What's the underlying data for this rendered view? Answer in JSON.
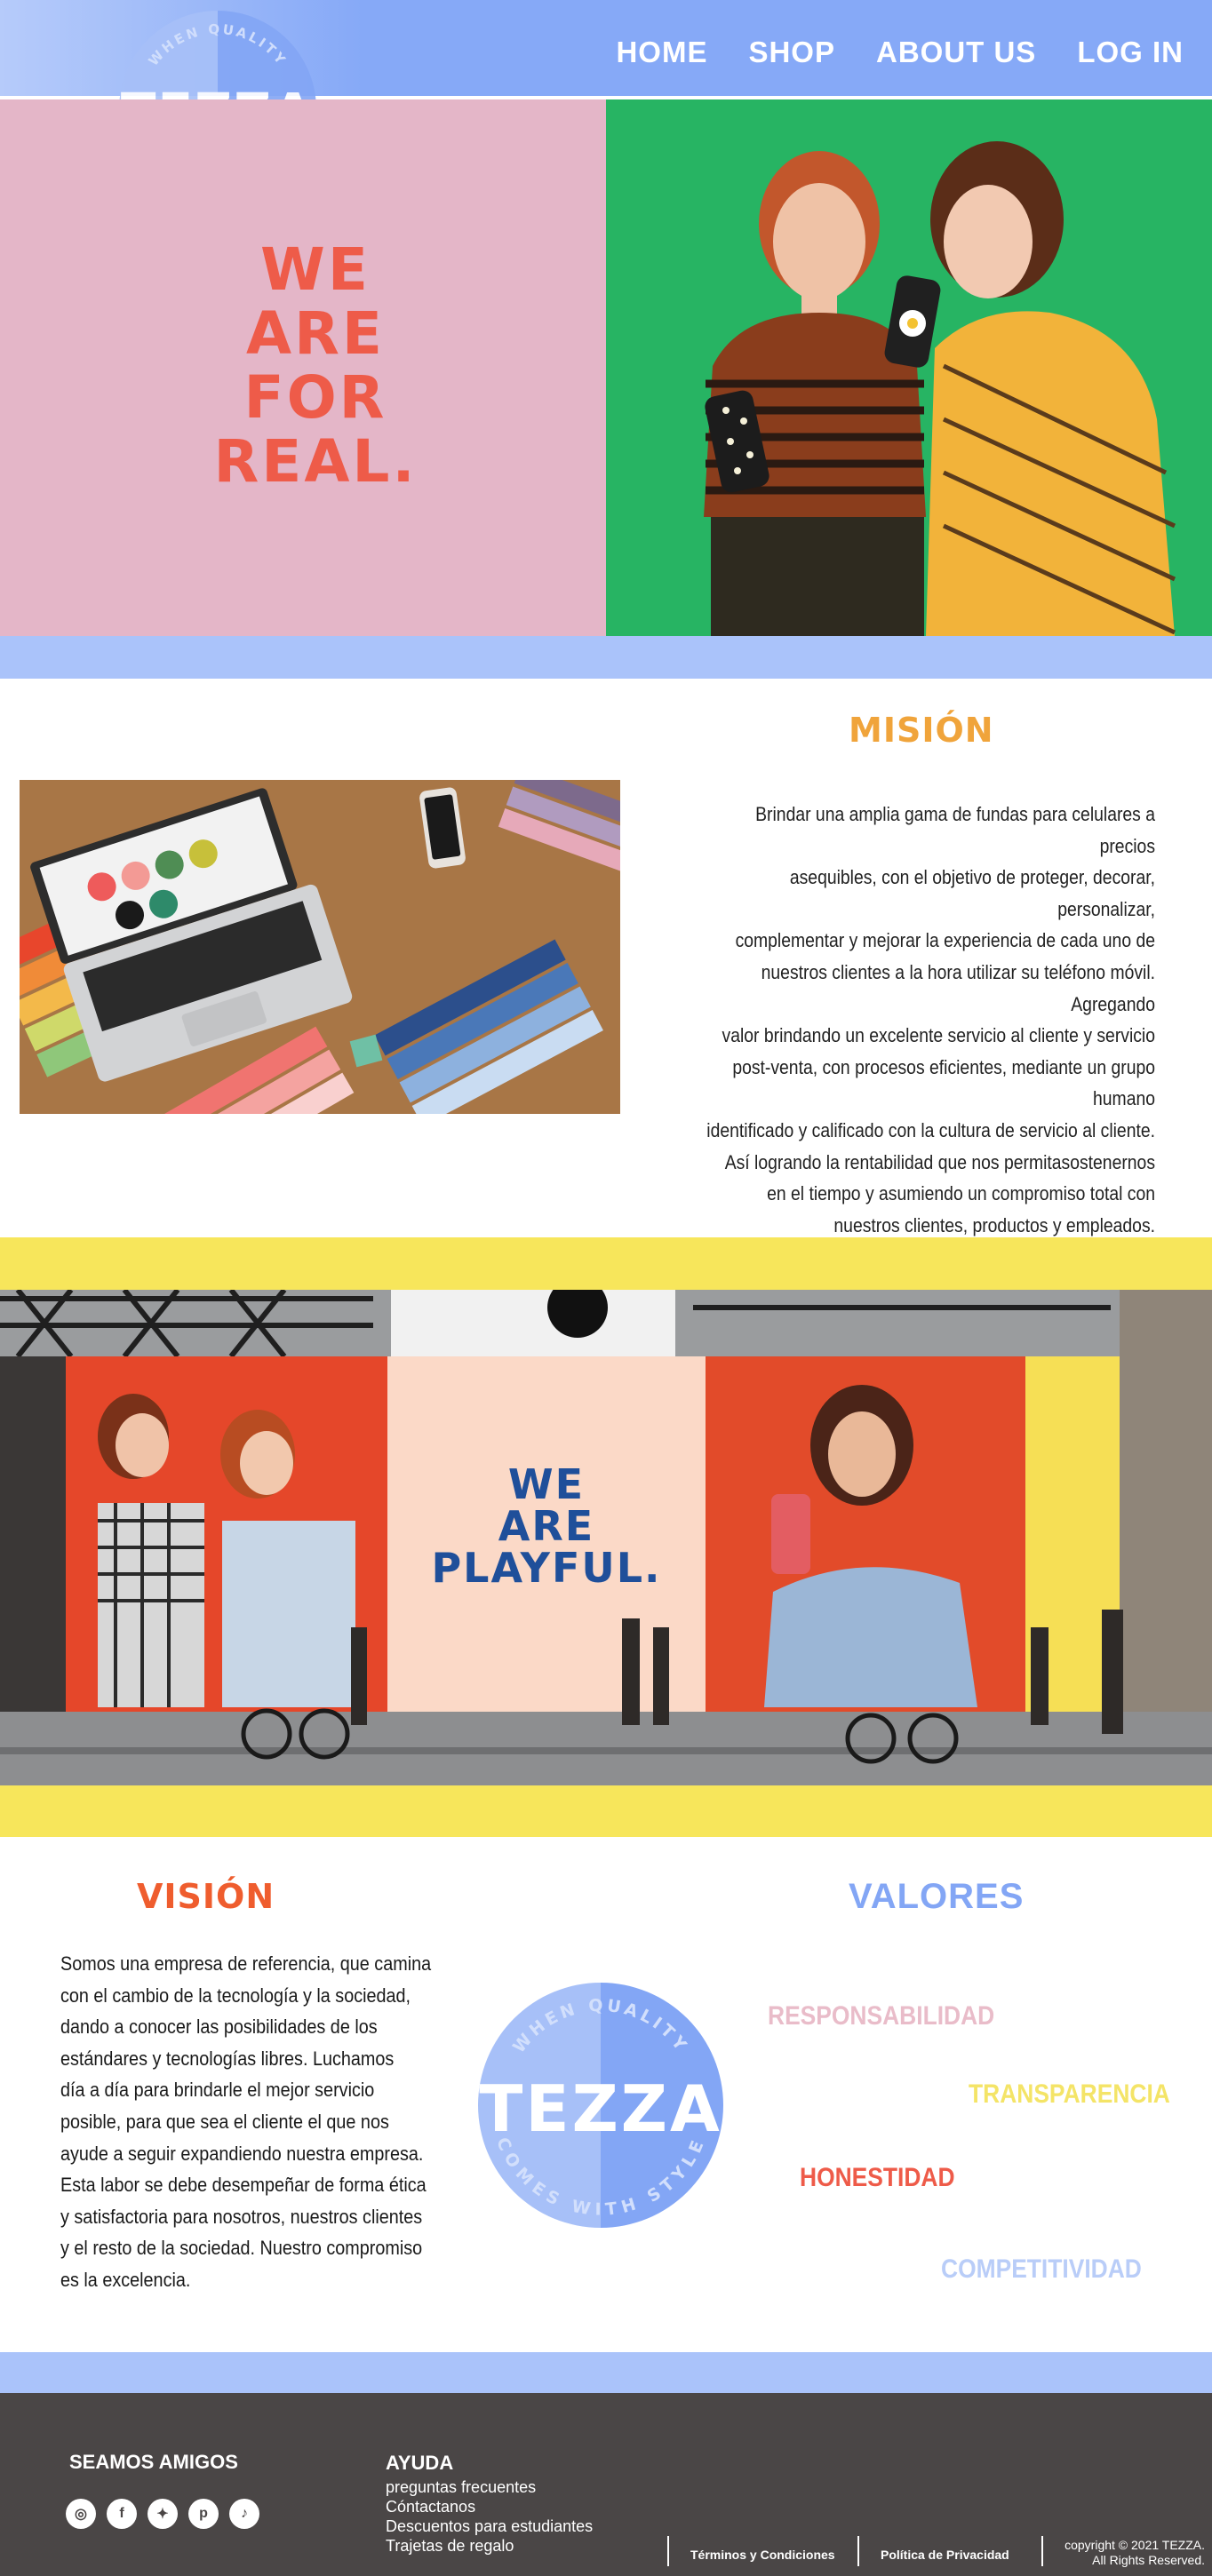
{
  "brand": {
    "name": "TEZZA",
    "tagline_top": "WHEN QUALITY",
    "tagline_bottom": "COMES WITH STYLE"
  },
  "nav": {
    "items": [
      {
        "label": "HOME"
      },
      {
        "label": "SHOP"
      },
      {
        "label": "ABOUT US"
      },
      {
        "label": "LOG IN"
      }
    ]
  },
  "hero": {
    "slogan": "WE ARE FOR REAL.",
    "background_color": "#e4b6c8",
    "slogan_color": "#ee5b49"
  },
  "mission": {
    "title": "MISIÓN",
    "text_lines": [
      "Brindar una amplia gama de fundas para celulares a precios",
      "asequibles, con el objetivo de proteger, decorar, personalizar,",
      "complementar y mejorar la experiencia de cada uno  de",
      "nuestros clientes a la hora utilizar su teléfono móvil. Agregando",
      "valor brindando un excelente servicio al cliente y servicio",
      "post-venta, con procesos eficientes, mediante un grupo humano",
      "identificado y calificado con la cultura de servicio al cliente.",
      "Así logrando la rentabilidad que nos permitasostenernos",
      "en el tiempo y asumiendo un compromiso total con",
      "nuestros clientes, productos y empleados."
    ]
  },
  "playful": {
    "slogan": "WE ARE PLAYFUL."
  },
  "vision": {
    "title": "VISIÓN",
    "text_lines": [
      "Somos una empresa de referencia, que camina",
      "con el cambio de la tecnología y la sociedad,",
      "dando a conocer las posibilidades de los",
      "estándares y tecnologías libres. Luchamos",
      "día a día para brindarle el mejor servicio",
      "posible, para que sea el cliente el que nos",
      "ayude a seguir expandiendo nuestra empresa.",
      "Esta labor se debe desempeñar de forma ética",
      "y satisfactoria para nosotros, nuestros clientes",
      "y el resto de la sociedad. Nuestro  compromiso",
      "es la excelencia."
    ]
  },
  "values": {
    "title": "VALORES",
    "items": [
      {
        "label": "RESPONSABILIDAD",
        "color": "#e9bcc9"
      },
      {
        "label": "TRANSPARENCIA",
        "color": "#f4e467"
      },
      {
        "label": "HONESTIDAD",
        "color": "#ee5b49"
      },
      {
        "label": "COMPETITIVIDAD",
        "color": "#b9cdf8"
      }
    ]
  },
  "footer": {
    "friends_title": "SEAMOS AMIGOS",
    "social_icons": [
      "instagram-icon",
      "facebook-icon",
      "twitter-icon",
      "pinterest-icon",
      "tiktok-icon"
    ],
    "help_title": "AYUDA",
    "help_links": [
      {
        "label": "preguntas frecuentes"
      },
      {
        "label": "Cóntactanos"
      },
      {
        "label": "Descuentos para estudiantes"
      },
      {
        "label": "Trajetas de regalo"
      }
    ],
    "terms": "Términos y Condiciones",
    "privacy": "Política de Privacidad",
    "copyright_line1": "copyright © 2021 TEZZA.",
    "copyright_line2": "All Rights Reserved."
  },
  "colors": {
    "accent_blue": "#86a9f7",
    "mission_title": "#f0a43b",
    "vision_title": "#ef5d2e",
    "yellow": "#f7e65b",
    "footer": "#4a4646"
  }
}
